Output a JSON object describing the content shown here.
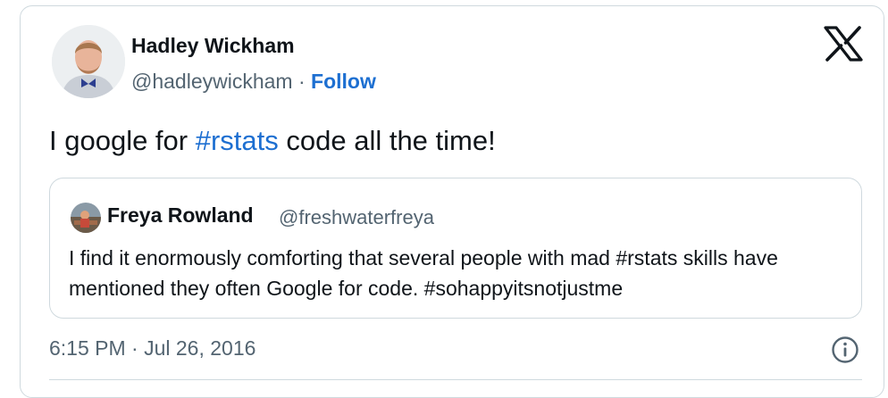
{
  "author": {
    "name": "Hadley Wickham",
    "handle": "@hadleywickham",
    "separator": "·",
    "follow_label": "Follow",
    "avatar_icon": "profile-photo"
  },
  "brand": {
    "logo_icon": "x-logo"
  },
  "tweet": {
    "text_before": "I google for ",
    "hashtag": "#rstats",
    "text_after": " code all the time!"
  },
  "quoted": {
    "name": "Freya Rowland",
    "handle": "@freshwaterfreya",
    "text": "I find it enormously comforting that several people with mad #rstats skills have mentioned they often Google for code. #sohappyitsnotjustme",
    "avatar_icon": "profile-photo"
  },
  "meta": {
    "timestamp": "6:15 PM · Jul 26, 2016",
    "info_icon": "info-icon"
  },
  "colors": {
    "link": "#1d6fd1",
    "secondary_text": "#536471",
    "border": "#cfd9de"
  }
}
